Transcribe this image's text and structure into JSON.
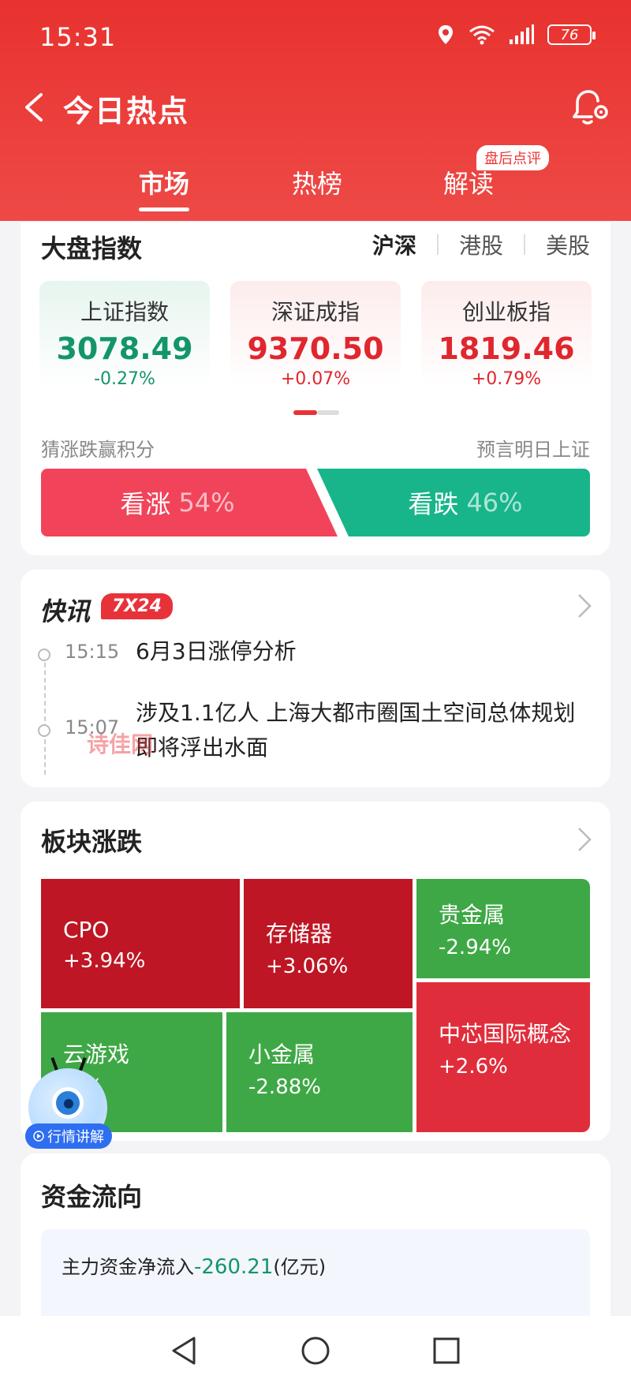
{
  "status": {
    "time": "15:31",
    "battery": "76"
  },
  "header": {
    "title": "今日热点"
  },
  "tabs": [
    {
      "label": "市场",
      "active": true
    },
    {
      "label": "热榜",
      "active": false
    },
    {
      "label": "解读",
      "active": false,
      "badge": "盘后点评"
    }
  ],
  "index_card": {
    "title": "大盘指数",
    "markets": [
      "沪深",
      "港股",
      "美股"
    ],
    "selected_market": "沪深",
    "indices": [
      {
        "name": "上证指数",
        "value": "3078.49",
        "change": "-0.27%",
        "trend": "down"
      },
      {
        "name": "深证成指",
        "value": "9370.50",
        "change": "+0.07%",
        "trend": "up"
      },
      {
        "name": "创业板指",
        "value": "1819.46",
        "change": "+0.79%",
        "trend": "up"
      }
    ],
    "guess_label": "猜涨跌赢积分",
    "predict_label": "预言明日上证",
    "vote_up": {
      "label": "看涨",
      "pct": "54%"
    },
    "vote_down": {
      "label": "看跌",
      "pct": "46%"
    }
  },
  "news_card": {
    "logo": "快讯",
    "badge": "7X24",
    "items": [
      {
        "time": "15:15",
        "text": "6月3日涨停分析"
      },
      {
        "time": "15:07",
        "text": "涉及1.1亿人 上海大都市圈国土空间总体规划即将浮出水面"
      }
    ],
    "watermark": "诗佳网"
  },
  "sector_card": {
    "title": "板块涨跌",
    "tiles": [
      {
        "name": "CPO",
        "change": "+3.94%"
      },
      {
        "name": "存储器",
        "change": "+3.06%"
      },
      {
        "name": "贵金属",
        "change": "-2.94%"
      },
      {
        "name": "云游戏",
        "change": "-3%"
      },
      {
        "name": "小金属",
        "change": "-2.88%"
      },
      {
        "name": "中芯国际概念",
        "change": "+2.6%"
      }
    ]
  },
  "fund_card": {
    "title": "资金流向",
    "line_label": "主力资金净流入",
    "line_value": "-260.21",
    "line_unit": "(亿元)"
  },
  "mascot": {
    "label": "行情讲解"
  },
  "colors": {
    "brand_red": "#e8322f",
    "up_red": "#e0262e",
    "down_green": "#13956a"
  }
}
